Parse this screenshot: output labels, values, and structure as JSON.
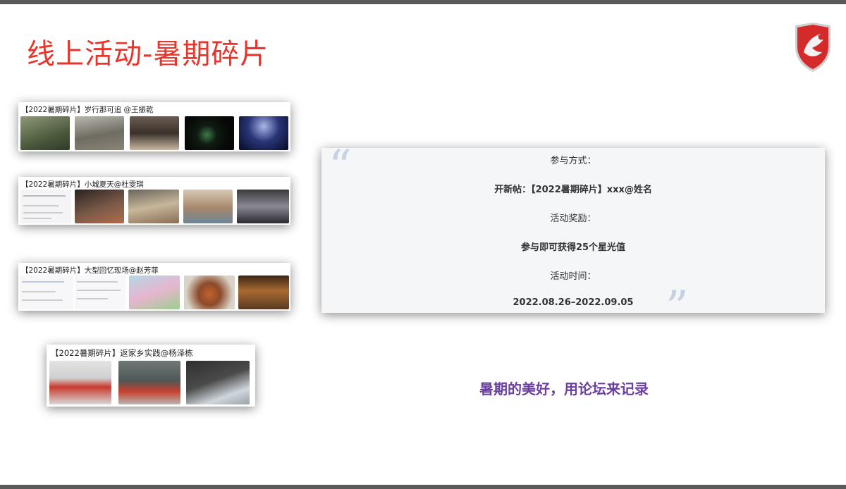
{
  "title": "线上活动-暑期碎片",
  "logo": {
    "icon": "dragon-shield-icon",
    "color": "#d42a2a"
  },
  "posts": [
    {
      "title": "【2022暑期碎片】岁行那可追 @王振乾"
    },
    {
      "title": "【2022暑期碎片】小城夏天@杜雯琪"
    },
    {
      "title": "【2022暑期碎片】大型回忆现场@赵芳菲"
    },
    {
      "title": "【2022暑期碎片】返家乡实践@杨泽栋"
    }
  ],
  "panel": {
    "line1": "参与方式：",
    "line2": "开新帖：【2022暑期碎片】xxx@姓名",
    "line3": "活动奖励：",
    "line4": "参与即可获得25个星光值",
    "line5": "活动时间：",
    "line6": "2022.08.26–2022.09.05",
    "quote_open": "“",
    "quote_close": "”"
  },
  "slogan": "暑期的美好，用论坛来记录",
  "colors": {
    "title": "#e8352b",
    "slogan": "#6a3fa0",
    "quote": "#c6d2e2"
  }
}
